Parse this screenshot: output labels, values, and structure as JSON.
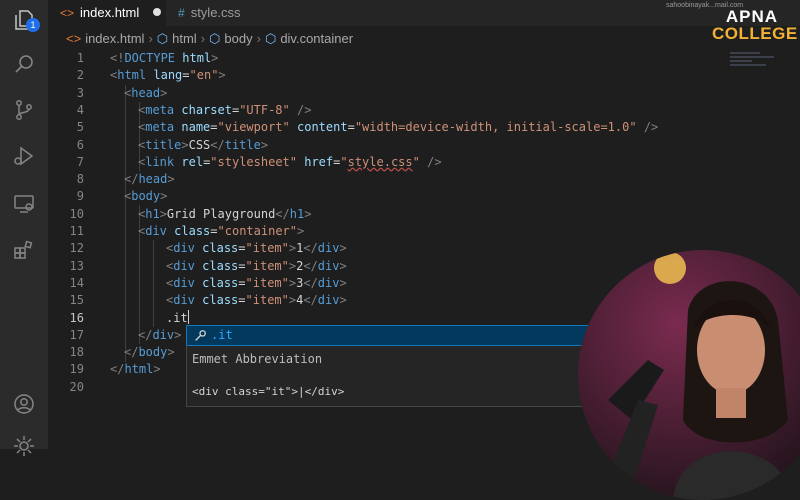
{
  "activity_bar": {
    "icons": [
      "files-icon",
      "search-icon",
      "source-control-icon",
      "run-debug-icon",
      "remote-explorer-icon",
      "extensions-icon",
      "account-icon",
      "settings-gear-icon"
    ],
    "explorer_badge": "1"
  },
  "tabs": [
    {
      "label": "index.html",
      "icon": "html-file-icon",
      "active": true,
      "modified": true
    },
    {
      "label": "style.css",
      "icon": "css-file-icon",
      "active": false,
      "modified": false
    }
  ],
  "breadcrumb": [
    "index.html",
    "html",
    "body",
    "div.container"
  ],
  "line_numbers": [
    "1",
    "2",
    "3",
    "4",
    "5",
    "6",
    "7",
    "8",
    "9",
    "10",
    "11",
    "12",
    "13",
    "14",
    "15",
    "16",
    "17",
    "18",
    "19",
    "20"
  ],
  "suggestion": {
    "item": ".it",
    "detail_title": "Emmet Abbreviation",
    "preview": "<div class=\"it\">|</div>"
  },
  "watermark": {
    "line1": "APNA",
    "line2": "COLLEGE",
    "email": "sahoobinayak...mail.com"
  },
  "colors": {
    "keyword": "#569cd6",
    "attribute": "#9cdcfe",
    "string": "#ce9178",
    "bracket": "#808080",
    "text": "#d4d4d4",
    "brand_accent": "#f2b233",
    "selection": "#04395e"
  }
}
